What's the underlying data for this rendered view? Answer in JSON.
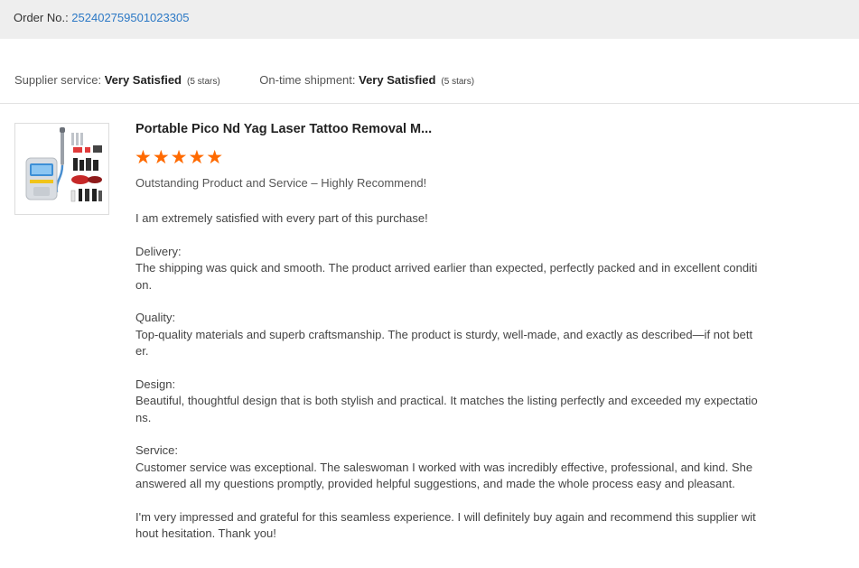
{
  "order": {
    "label": "Order No.: ",
    "number": "252402759501023305"
  },
  "ratings": {
    "supplier_label": "Supplier service: ",
    "supplier_value": "Very Satisfied",
    "supplier_stars": "(5 stars)",
    "shipment_label": "On-time shipment: ",
    "shipment_value": "Very Satisfied",
    "shipment_stars": "(5 stars)"
  },
  "product": {
    "title": "Portable Pico Nd Yag Laser Tattoo Removal M...",
    "image_icon": "laser-machine-product-image"
  },
  "review": {
    "stars": "★★★★★",
    "star_count": 5,
    "star_color": "#ff6a00",
    "headline": "Outstanding Product and Service – Highly Recommend!",
    "intro": "I am extremely satisfied with every part of this purchase!",
    "delivery_title": "Delivery:",
    "delivery_text": "The shipping was quick and smooth. The product arrived earlier than expected, perfectly packed and in excellent condition.",
    "quality_title": "Quality:",
    "quality_text": "Top-quality materials and superb craftsmanship. The product is sturdy, well-made, and exactly as described—if not better.",
    "design_title": "Design:",
    "design_text": "Beautiful, thoughtful design that is both stylish and practical. It matches the listing perfectly and exceeded my expectations.",
    "service_title": "Service:",
    "service_text": "Customer service was exceptional. The saleswoman I worked with was incredibly effective, professional, and kind. She answered all my questions promptly, provided helpful suggestions, and made the whole process easy and pleasant.",
    "closing": "I'm very impressed and grateful for this seamless experience. I will definitely buy again and recommend this supplier without hesitation. Thank you!"
  },
  "colors": {
    "link": "#2b78c5",
    "star": "#ff6a00",
    "order_bar": "#eeeeee"
  }
}
